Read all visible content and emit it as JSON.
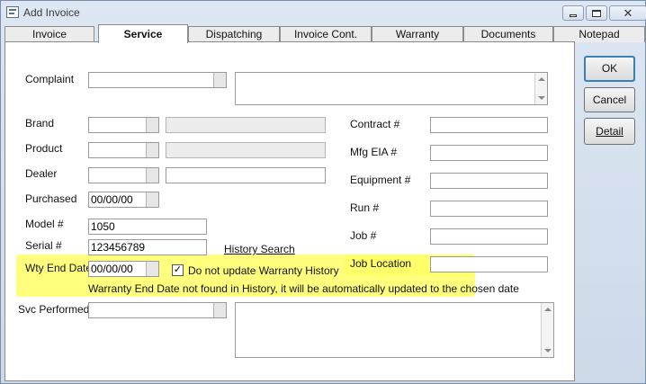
{
  "window": {
    "title": "Add Invoice",
    "icon": "invoice-app-icon"
  },
  "tabs": [
    {
      "label": "Invoice"
    },
    {
      "label": "Service"
    },
    {
      "label": "Dispatching"
    },
    {
      "label": "Invoice Cont."
    },
    {
      "label": "Warranty"
    },
    {
      "label": "Documents"
    },
    {
      "label": "Notepad"
    }
  ],
  "active_tab": "Service",
  "buttons": {
    "ok": "OK",
    "cancel": "Cancel",
    "detail": "Detail"
  },
  "form": {
    "complaint_label": "Complaint",
    "brand_label": "Brand",
    "product_label": "Product",
    "dealer_label": "Dealer",
    "purchased_label": "Purchased",
    "purchased_value": "00/00/00",
    "model_label": "Model #",
    "model_value": "1050",
    "serial_label": "Serial #",
    "serial_value": "123456789",
    "history_search": "History Search",
    "wty_end_label": "Wty End Date",
    "wty_end_value": "00/00/00",
    "no_update_label": "Do not update Warranty History",
    "no_update_checked": true,
    "warranty_message": "Warranty End Date not found in History, it will be automatically updated to the chosen date",
    "svc_performed_label": "Svc Performed",
    "contract_label": "Contract #",
    "mfg_eia_label": "Mfg EIA #",
    "equipment_label": "Equipment #",
    "run_label": "Run #",
    "job_label": "Job #",
    "job_location_label": "Job Location"
  },
  "colors": {
    "highlight": "#ffff66",
    "default_button_border": "#3c7fb1"
  }
}
